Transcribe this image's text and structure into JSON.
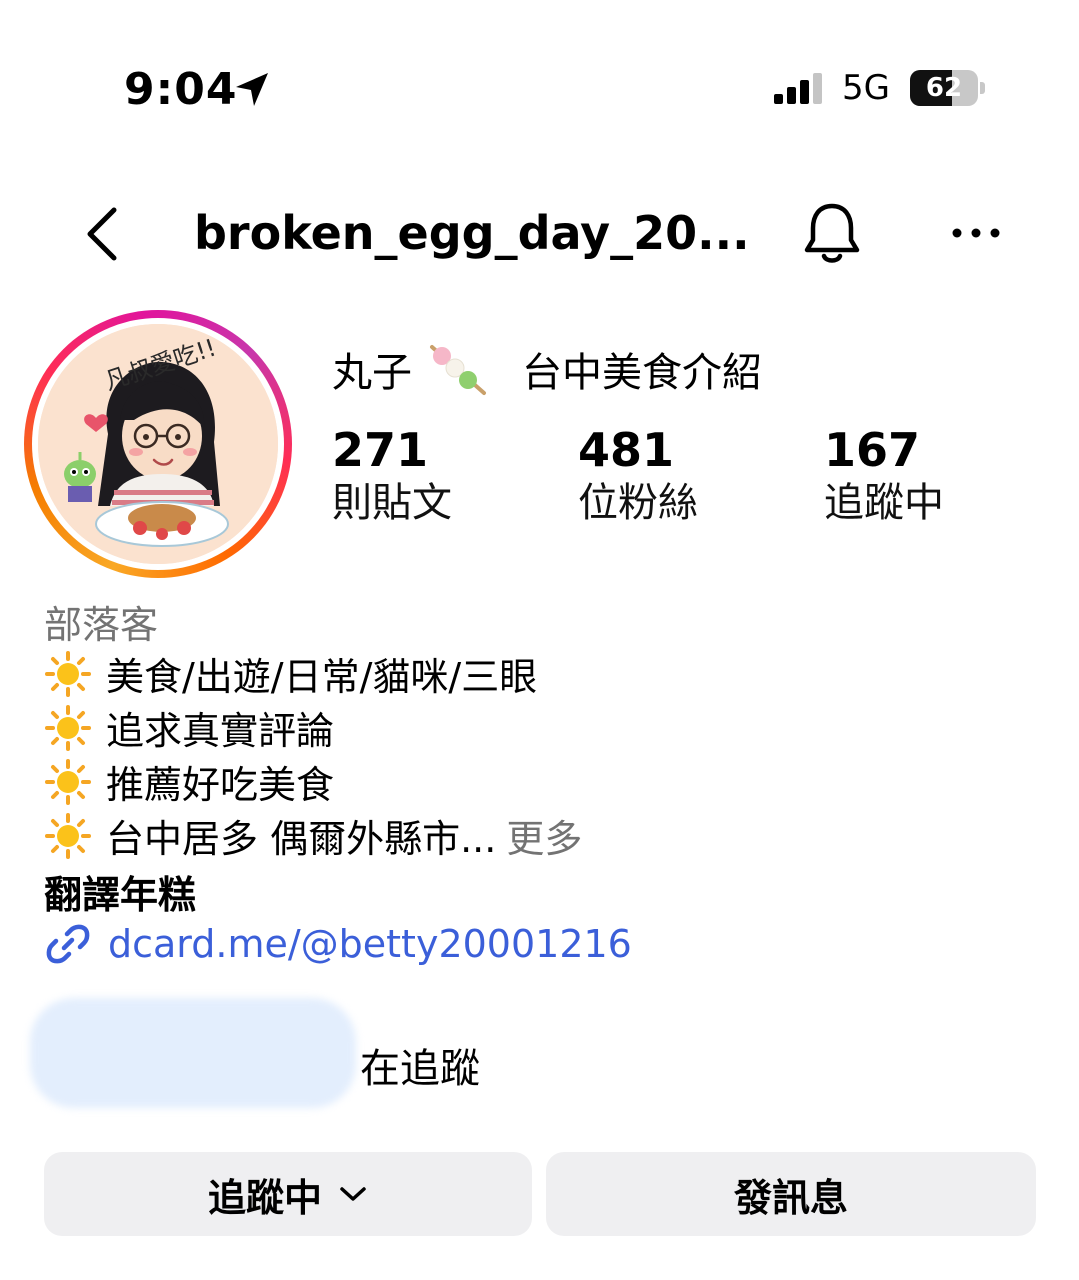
{
  "status_bar": {
    "time": "9:04",
    "network": "5G",
    "battery_level": "62",
    "battery_fraction": 0.62,
    "icons": [
      "location-arrow-icon",
      "signal-bars-icon",
      "battery-icon"
    ]
  },
  "nav": {
    "username": "broken_egg_day_20...",
    "icons": [
      "back-chevron-icon",
      "bell-icon",
      "more-dots-icon"
    ]
  },
  "profile": {
    "name_part1": "丸子",
    "name_part2": "台中美食介紹",
    "name_emoji_icon": "dango-icon",
    "avatar_text": "凡叔愛吃!!"
  },
  "stats": [
    {
      "value": "271",
      "label": "則貼文"
    },
    {
      "value": "481",
      "label": "位粉絲"
    },
    {
      "value": "167",
      "label": "追蹤中"
    }
  ],
  "bio": {
    "category": "部落客",
    "lines": [
      "美食/出遊/日常/貓咪/三眼",
      "追求真實評論",
      "推薦好吃美食",
      "台中居多 偶爾外縣市..."
    ],
    "line_icon": "sun-icon",
    "more_label": "更多",
    "name_line": "翻譯年糕",
    "link": "dcard.me/@betty20001216",
    "link_icon": "link-icon"
  },
  "followed_by": {
    "suffix": "在追蹤"
  },
  "actions": {
    "follow_label": "追蹤中",
    "message_label": "發訊息"
  },
  "colors": {
    "link": "#3b5fd9",
    "secondary_text": "#737373",
    "button_bg": "#efeff1",
    "ring_start": "#f9a825",
    "ring_end": "#e1149c"
  }
}
